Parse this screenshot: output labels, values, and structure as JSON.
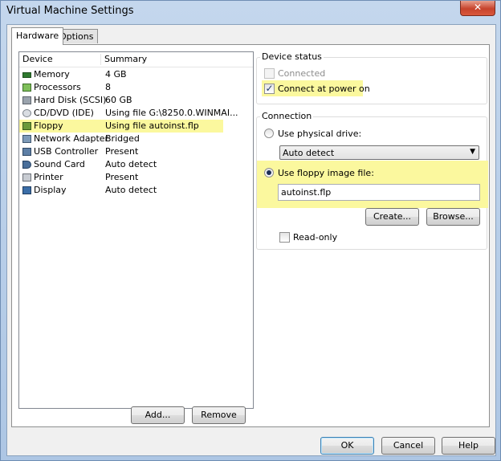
{
  "window": {
    "title": "Virtual Machine Settings",
    "close_symbol": "✕"
  },
  "tabs": [
    {
      "label": "Hardware",
      "active": true
    },
    {
      "label": "Options",
      "active": false
    }
  ],
  "device_list": {
    "columns": [
      "Device",
      "Summary"
    ],
    "rows": [
      {
        "icon": "memory-icon",
        "name": "Memory",
        "summary": "4 GB"
      },
      {
        "icon": "processor-icon",
        "name": "Processors",
        "summary": "8"
      },
      {
        "icon": "hard-disk-icon",
        "name": "Hard Disk (SCSI)",
        "summary": "60 GB"
      },
      {
        "icon": "cd-dvd-icon",
        "name": "CD/DVD (IDE)",
        "summary": "Using file G:\\8250.0.WINMAI..."
      },
      {
        "icon": "floppy-icon",
        "name": "Floppy",
        "summary": "Using file autoinst.flp",
        "selected": true
      },
      {
        "icon": "network-adapter-icon",
        "name": "Network Adapter",
        "summary": "Bridged"
      },
      {
        "icon": "usb-icon",
        "name": "USB Controller",
        "summary": "Present"
      },
      {
        "icon": "sound-card-icon",
        "name": "Sound Card",
        "summary": "Auto detect"
      },
      {
        "icon": "printer-icon",
        "name": "Printer",
        "summary": "Present"
      },
      {
        "icon": "display-icon",
        "name": "Display",
        "summary": "Auto detect"
      }
    ]
  },
  "list_buttons": {
    "add": "Add...",
    "remove": "Remove"
  },
  "device_status": {
    "legend": "Device status",
    "connected": {
      "label": "Connected",
      "checked": false,
      "enabled": false
    },
    "connect_at_power_on": {
      "label": "Connect at power on",
      "checked": true
    }
  },
  "connection": {
    "legend": "Connection",
    "physical_drive": {
      "label": "Use physical drive:",
      "selected": false
    },
    "drive_select": {
      "value": "Auto detect"
    },
    "image_file": {
      "label": "Use floppy image file:",
      "selected": true
    },
    "image_path": "autoinst.flp",
    "create_button": "Create...",
    "browse_button": "Browse...",
    "read_only": {
      "label": "Read-only",
      "checked": false
    }
  },
  "dialog_buttons": {
    "ok": "OK",
    "cancel": "Cancel",
    "help": "Help"
  },
  "colors": {
    "highlight": "#fbf89e",
    "title_bar": "#b9d1ea",
    "close_button": "#c7432c"
  }
}
